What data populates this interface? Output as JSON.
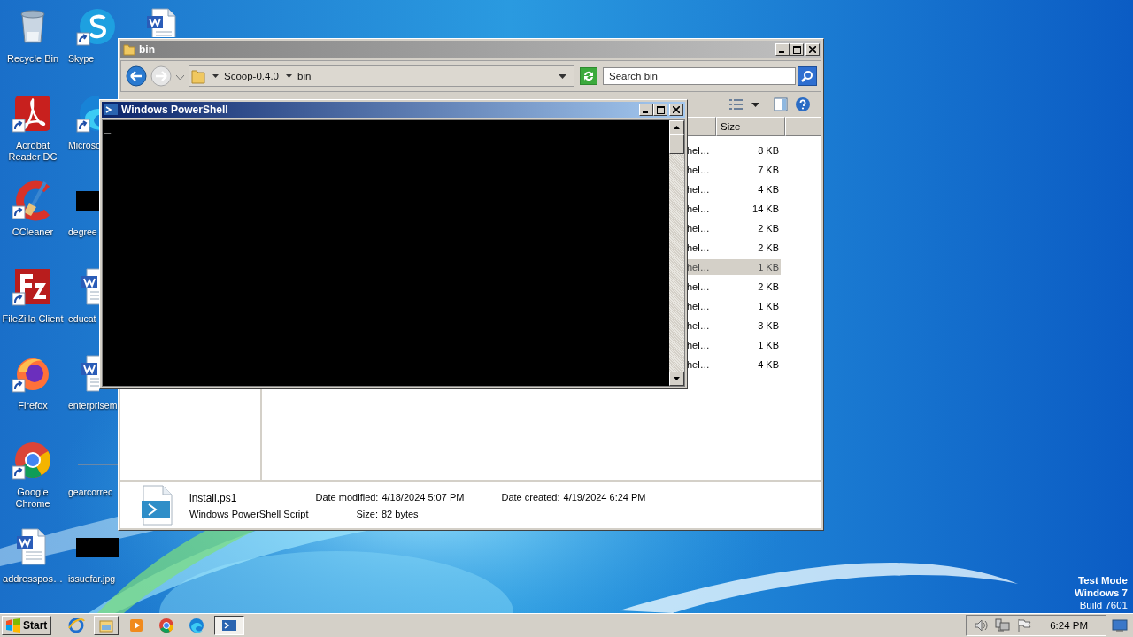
{
  "desktop": {
    "icons": [
      {
        "kind": "recycle",
        "label": "Recycle Bin",
        "shortcut": false
      },
      {
        "kind": "acrobat",
        "label": "Acrobat Reader DC",
        "shortcut": true
      },
      {
        "kind": "ccleaner",
        "label": "CCleaner",
        "shortcut": true
      },
      {
        "kind": "filezilla",
        "label": "FileZilla Client",
        "shortcut": true
      },
      {
        "kind": "firefox",
        "label": "Firefox",
        "shortcut": true
      },
      {
        "kind": "chrome",
        "label": "Google Chrome",
        "shortcut": true
      },
      {
        "kind": "word",
        "label": "addresspos…",
        "shortcut": false
      },
      {
        "kind": "skype",
        "label": "Skype",
        "shortcut": true
      },
      {
        "kind": "edge",
        "label": "Microso",
        "shortcut": true
      },
      {
        "kind": "dark-image",
        "label": "degree",
        "shortcut": false
      },
      {
        "kind": "word",
        "label": "educat",
        "shortcut": false
      },
      {
        "kind": "word",
        "label": "enterprisem",
        "shortcut": false
      },
      {
        "kind": "line-image",
        "label": "gearcorrec",
        "shortcut": false
      },
      {
        "kind": "dark-image",
        "label": "issuefar.jpg",
        "shortcut": false
      },
      {
        "kind": "word",
        "shortcut": false
      }
    ]
  },
  "explorer": {
    "title": "bin",
    "breadcrumbs": [
      "Scoop-0.4.0",
      "bin"
    ],
    "search": {
      "placeholder": "Search bin"
    },
    "columns": [
      "Size"
    ],
    "rows": [
      {
        "type": "hel…",
        "size": "8 KB",
        "selected": false
      },
      {
        "type": "hel…",
        "size": "7 KB",
        "selected": false
      },
      {
        "type": "hel…",
        "size": "4 KB",
        "selected": false
      },
      {
        "type": "hel…",
        "size": "14 KB",
        "selected": false
      },
      {
        "type": "hel…",
        "size": "2 KB",
        "selected": false
      },
      {
        "type": "hel…",
        "size": "2 KB",
        "selected": false
      },
      {
        "type": "hel…",
        "size": "1 KB",
        "selected": true
      },
      {
        "type": "hel…",
        "size": "2 KB",
        "selected": false
      },
      {
        "type": "hel…",
        "size": "1 KB",
        "selected": false
      },
      {
        "type": "hel…",
        "size": "3 KB",
        "selected": false
      },
      {
        "type": "hel…",
        "size": "1 KB",
        "selected": false
      },
      {
        "type": "hel…",
        "size": "4 KB",
        "selected": false
      }
    ],
    "details": {
      "name": "install.ps1",
      "type": "Windows PowerShell Script",
      "fields": [
        {
          "label": "Date modified:",
          "value": "4/18/2024 5:07 PM"
        },
        {
          "label": "Date created:",
          "value": "4/19/2024 6:24 PM"
        },
        {
          "label": "Size:",
          "value": "82 bytes"
        }
      ]
    }
  },
  "powershell": {
    "title": "Windows PowerShell",
    "cursor": "_"
  },
  "taskbar": {
    "start": "Start",
    "apps": [
      {
        "kind": "ie",
        "active": false
      },
      {
        "kind": "explorer",
        "active": false
      },
      {
        "kind": "media",
        "active": false
      },
      {
        "kind": "chrome",
        "active": false
      },
      {
        "kind": "edge",
        "active": false
      },
      {
        "kind": "powershell",
        "active": true
      }
    ],
    "clock": "6:24 PM"
  },
  "test_mode": [
    "Test Mode",
    "Windows 7",
    "Build 7601"
  ]
}
